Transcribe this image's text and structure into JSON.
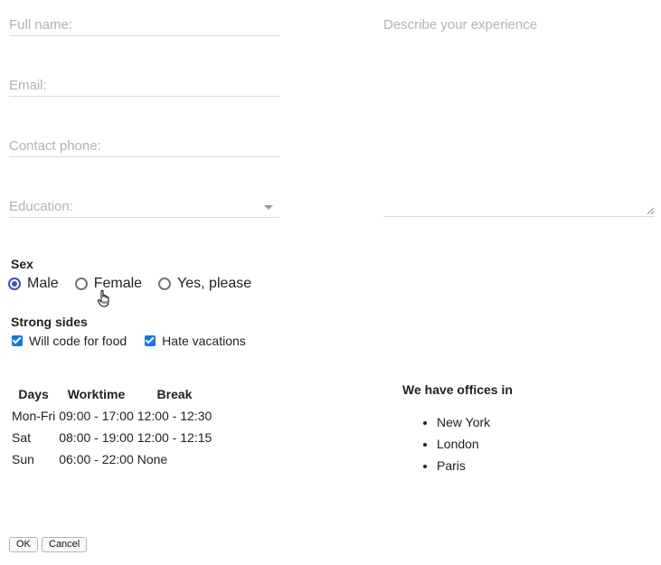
{
  "form": {
    "full_name_placeholder": "Full name:",
    "email_placeholder": "Email:",
    "phone_placeholder": "Contact phone:",
    "education_placeholder": "Education:",
    "experience_placeholder": "Describe your experience"
  },
  "sex": {
    "label": "Sex",
    "options": [
      "Male",
      "Female",
      "Yes, please"
    ],
    "selected": "Male"
  },
  "strong_sides": {
    "label": "Strong sides",
    "options": [
      {
        "label": "Will code for food",
        "checked": true
      },
      {
        "label": "Hate vacations",
        "checked": true
      }
    ]
  },
  "schedule": {
    "headers": [
      "Days",
      "Worktime",
      "Break"
    ],
    "rows": [
      [
        "Mon-Fri",
        "09:00 - 17:00",
        "12:00 - 12:30"
      ],
      [
        "Sat",
        "08:00 - 19:00",
        "12:00 - 12:15"
      ],
      [
        "Sun",
        "06:00 - 22:00",
        "None"
      ]
    ]
  },
  "offices": {
    "title": "We have offices in",
    "cities": [
      "New York",
      "London",
      "Paris"
    ]
  },
  "buttons": {
    "ok": "OK",
    "cancel": "Cancel"
  },
  "colors": {
    "radio_accent": "#3f51b5",
    "checkbox_accent": "#1a73e8",
    "placeholder": "#b3b3b3"
  }
}
